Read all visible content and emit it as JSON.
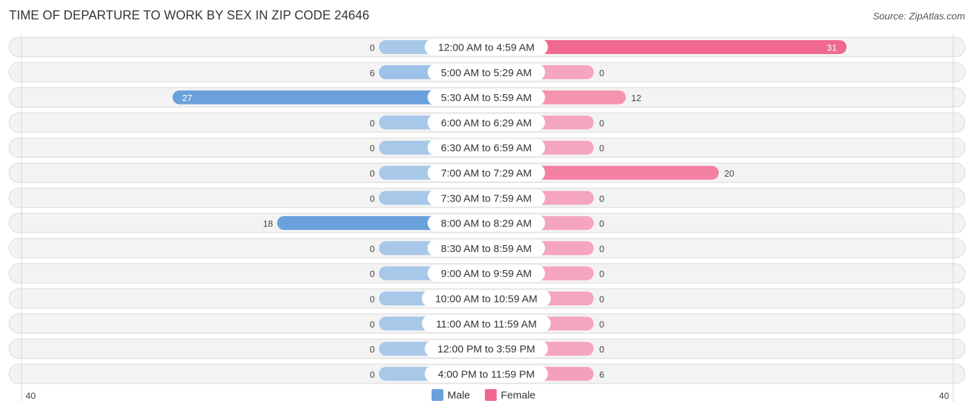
{
  "header": {
    "title": "TIME OF DEPARTURE TO WORK BY SEX IN ZIP CODE 24646",
    "source": "Source: ZipAtlas.com"
  },
  "colors": {
    "male_strong": "#6aa1dc",
    "male_light": "#a8c8ea",
    "female_strong": "#f06890",
    "female_light": "#f5a5bd"
  },
  "chart_data": {
    "type": "bar",
    "orientation": "horizontal-diverging",
    "title": "TIME OF DEPARTURE TO WORK BY SEX IN ZIP CODE 24646",
    "categories": [
      "12:00 AM to 4:59 AM",
      "5:00 AM to 5:29 AM",
      "5:30 AM to 5:59 AM",
      "6:00 AM to 6:29 AM",
      "6:30 AM to 6:59 AM",
      "7:00 AM to 7:29 AM",
      "7:30 AM to 7:59 AM",
      "8:00 AM to 8:29 AM",
      "8:30 AM to 8:59 AM",
      "9:00 AM to 9:59 AM",
      "10:00 AM to 10:59 AM",
      "11:00 AM to 11:59 AM",
      "12:00 PM to 3:59 PM",
      "4:00 PM to 11:59 PM"
    ],
    "series": [
      {
        "name": "Male",
        "values": [
          0,
          6,
          27,
          0,
          0,
          0,
          0,
          18,
          0,
          0,
          0,
          0,
          0,
          0
        ]
      },
      {
        "name": "Female",
        "values": [
          31,
          0,
          12,
          0,
          0,
          20,
          0,
          0,
          0,
          0,
          0,
          0,
          0,
          6
        ]
      }
    ],
    "xlim": [
      -40,
      40
    ],
    "axis_labels": {
      "left": "40",
      "right": "40"
    },
    "legend": {
      "position": "bottom-center",
      "entries": [
        "Male",
        "Female"
      ]
    },
    "grid": false
  }
}
